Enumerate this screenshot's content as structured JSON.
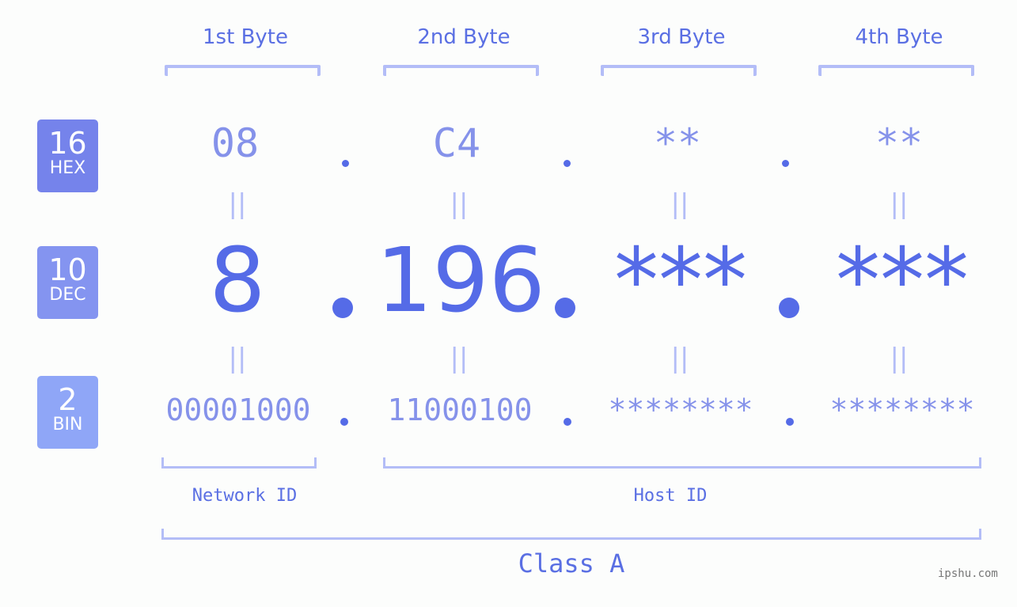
{
  "headers": [
    "1st Byte",
    "2nd Byte",
    "3rd Byte",
    "4th Byte"
  ],
  "rows": {
    "hex": {
      "base": "16",
      "label": "HEX",
      "values": [
        "08",
        "C4",
        "**",
        "**"
      ],
      "color": "#7583eb"
    },
    "dec": {
      "base": "10",
      "label": "DEC",
      "values": [
        "8",
        "196",
        "***",
        "***"
      ],
      "color": "#8494f0"
    },
    "bin": {
      "base": "2",
      "label": "BIN",
      "values": [
        "00001000",
        "11000100",
        "********",
        "********"
      ],
      "color": "#8fa6f7"
    }
  },
  "separator": ".",
  "equals": "||",
  "network_label": "Network ID",
  "host_label": "Host ID",
  "class_label": "Class A",
  "watermark": "ipshu.com",
  "colors": {
    "accent": "#556be7",
    "light": "#b3bdf7",
    "mid": "#8592ea"
  }
}
